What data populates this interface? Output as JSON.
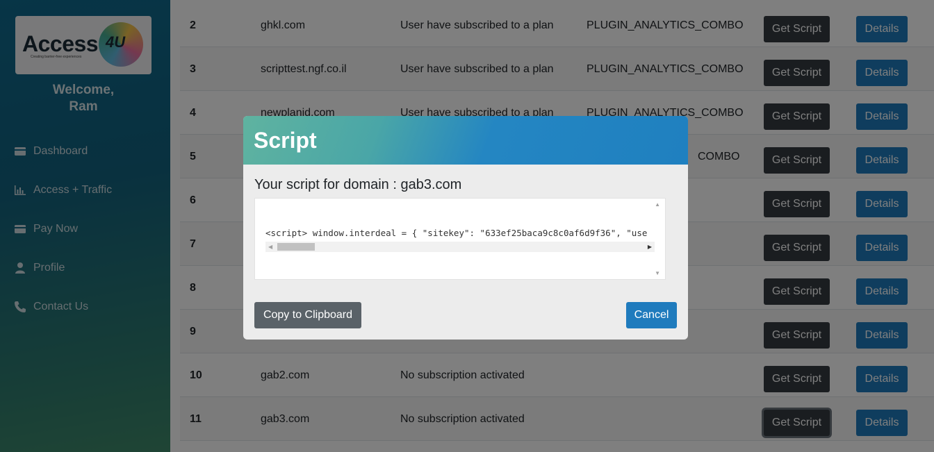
{
  "sidebar": {
    "logo_text": "Access",
    "logo_suffix": "4U",
    "logo_tagline": "Creating barrier-free experiences",
    "welcome_line1": "Welcome,",
    "welcome_line2": "Ram",
    "items": [
      {
        "label": "Dashboard",
        "icon": "card-icon"
      },
      {
        "label": "Access + Traffic",
        "icon": "bar-chart-icon"
      },
      {
        "label": "Pay Now",
        "icon": "card-icon"
      },
      {
        "label": "Profile",
        "icon": "user-icon"
      },
      {
        "label": "Contact Us",
        "icon": "phone-icon"
      }
    ]
  },
  "table": {
    "get_script_label": "Get Script",
    "details_label": "Details",
    "rows": [
      {
        "num": "2",
        "domain": "ghkl.com",
        "status": "User have subscribed to a plan",
        "plan": "PLUGIN_ANALYTICS_COMBO"
      },
      {
        "num": "3",
        "domain": "scripttest.ngf.co.il",
        "status": "User have subscribed to a plan",
        "plan": "PLUGIN_ANALYTICS_COMBO"
      },
      {
        "num": "4",
        "domain": "newplanid.com",
        "status": "User have subscribed to a plan",
        "plan": "PLUGIN_ANALYTICS_COMBO"
      },
      {
        "num": "5",
        "domain": "",
        "status": "",
        "plan": "COMBO"
      },
      {
        "num": "6",
        "domain": "",
        "status": "",
        "plan": ""
      },
      {
        "num": "7",
        "domain": "",
        "status": "",
        "plan": ""
      },
      {
        "num": "8",
        "domain": "",
        "status": "",
        "plan": ""
      },
      {
        "num": "9",
        "domain": "",
        "status": "",
        "plan": ""
      },
      {
        "num": "10",
        "domain": "gab2.com",
        "status": "No subscription activated",
        "plan": ""
      },
      {
        "num": "11",
        "domain": "gab3.com",
        "status": "No subscription activated",
        "plan": ""
      }
    ]
  },
  "modal": {
    "title": "Script",
    "subtitle": "Your script for domain : gab3.com",
    "code": "<script> window.interdeal = { \"sitekey\": \"633ef25baca9c8c0af6d9f36\", \"use",
    "copy_label": "Copy to Clipboard",
    "cancel_label": "Cancel"
  },
  "colors": {
    "primary": "#1f7bbd",
    "dark_button": "#343a40",
    "secondary_button": "#5a6268"
  }
}
